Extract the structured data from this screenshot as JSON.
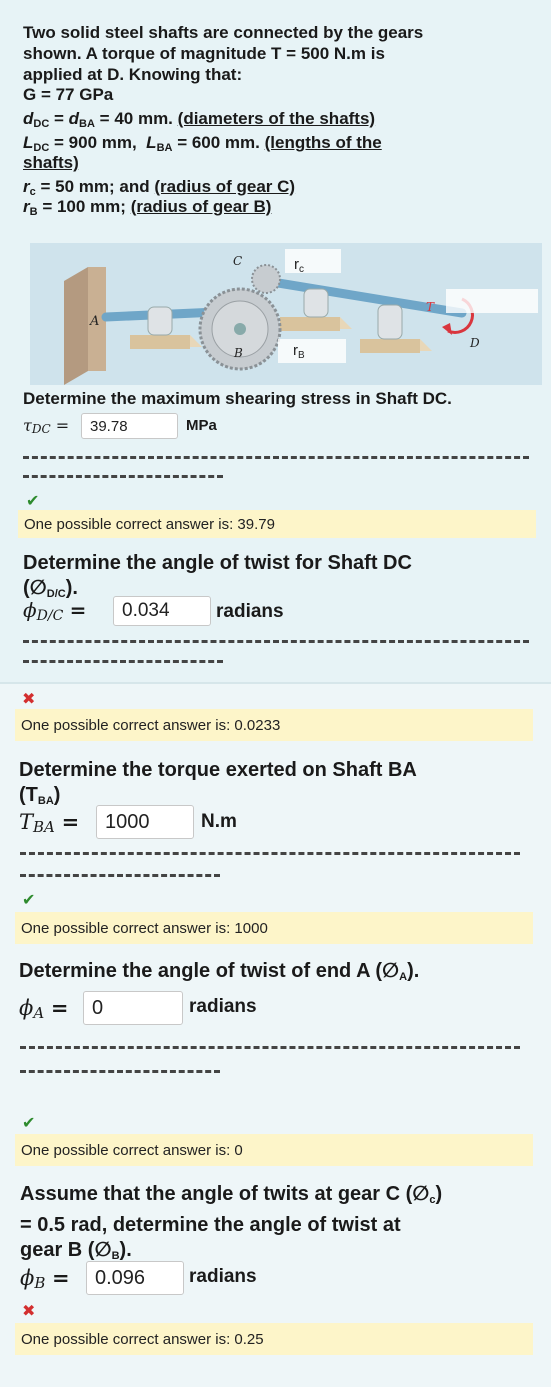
{
  "problem": {
    "line1": "Two solid steel shafts are connected by the gears",
    "line2": "shown. A torque of magnitude T = 500 N.m is",
    "line3": "applied at D. Knowing that:",
    "g_line": "G = 77 GPa",
    "d_eq": "= 40 mm.",
    "d_note": "(diameters of the shafts)",
    "l_eq1": "= 900 mm,",
    "l_eq2": "= 600 mm.",
    "l_note1": "(lengths of the",
    "l_note2": "shafts)",
    "rc_eq": "= 50 mm; and",
    "rc_note": "(radius of gear C)",
    "rb_eq": "= 100 mm;",
    "rb_note": "(radius of gear B)"
  },
  "figure": {
    "label_A": "A",
    "label_B": "B",
    "label_C": "C",
    "label_D": "D",
    "label_T": "T",
    "label_rc": "r",
    "label_rc_sub": "c",
    "label_rb": "r",
    "label_rb_sub": "B"
  },
  "questions": [
    {
      "text": "Determine the maximum shearing stress in Shaft DC.",
      "symbol": "τDC",
      "value": "39.78",
      "unit": "MPa",
      "status": "correct",
      "hint": "One possible correct answer is: 39.79"
    },
    {
      "text1": "Determine the angle of twist for Shaft DC",
      "text2": "(∅",
      "text2_sub": "D/C",
      "text2_end": ").",
      "symbol": "ϕD/C",
      "value": "0.034",
      "unit": "radians",
      "status": "incorrect",
      "hint": "One possible correct answer is: 0.0233"
    },
    {
      "text1": "Determine the torque exerted on Shaft BA",
      "text2": "(T",
      "text2_sub": "BA",
      "text2_end": ")",
      "symbol": "TBA",
      "value": "1000",
      "unit": "N.m",
      "status": "correct",
      "hint": "One possible correct answer is: 1000"
    },
    {
      "text1": "Determine the angle of twist of end A (∅",
      "text1_sub": "A",
      "text1_end": ").",
      "symbol": "ϕA",
      "value": "0",
      "unit": "radians",
      "status": "correct",
      "hint": "One possible correct answer is: 0"
    },
    {
      "text1": "Assume that the angle of twits at gear C (∅",
      "text1_sub": "c",
      "text1_end": ")",
      "text2": "= 0.5 rad, determine the angle of twist at",
      "text3": "gear B (∅",
      "text3_sub": "B",
      "text3_end": ").",
      "symbol": "ϕB",
      "value": "0.096",
      "unit": "radians",
      "status": "incorrect",
      "hint": "One possible correct answer is: 0.25"
    }
  ],
  "marks": {
    "correct": "✔",
    "incorrect": "✖"
  },
  "colors": {
    "correct": "#2e8b2e",
    "incorrect": "#d32f2f",
    "hint_bg": "#fdf5c9"
  }
}
